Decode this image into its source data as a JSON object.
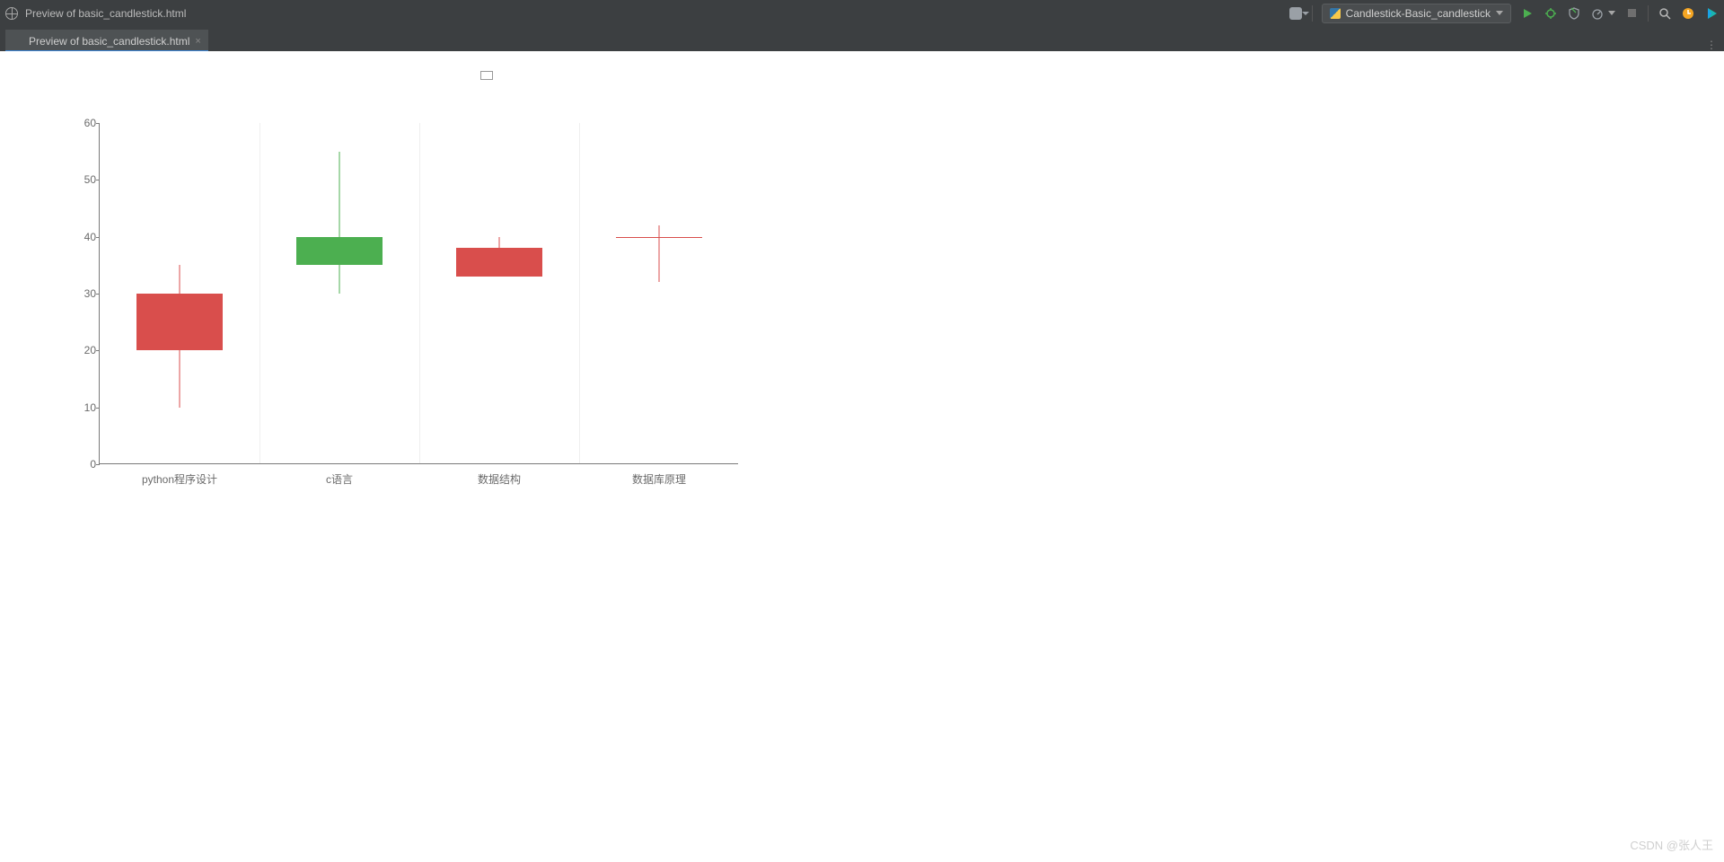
{
  "ide": {
    "title": "Preview of basic_candlestick.html",
    "run_config": "Candlestick-Basic_candlestick"
  },
  "tab": {
    "label": "Preview of basic_candlestick.html"
  },
  "watermark": "CSDN @张人王",
  "chart_data": {
    "type": "candlestick",
    "categories": [
      "python程序设计",
      "c语言",
      "数据结构",
      "数据库原理"
    ],
    "series": [
      {
        "name": "python程序设计",
        "open": 20,
        "close": 30,
        "low": 10,
        "high": 35
      },
      {
        "name": "c语言",
        "open": 40,
        "close": 35,
        "low": 30,
        "high": 55
      },
      {
        "name": "数据结构",
        "open": 33,
        "close": 38,
        "low": 33,
        "high": 40
      },
      {
        "name": "数据库原理",
        "open": 40,
        "close": 40,
        "low": 32,
        "high": 42
      }
    ],
    "colors": {
      "up": "#d94e4c",
      "down": "#4caf50"
    },
    "yticks": [
      0,
      10,
      20,
      30,
      40,
      50,
      60
    ],
    "ylim": [
      0,
      60
    ]
  }
}
